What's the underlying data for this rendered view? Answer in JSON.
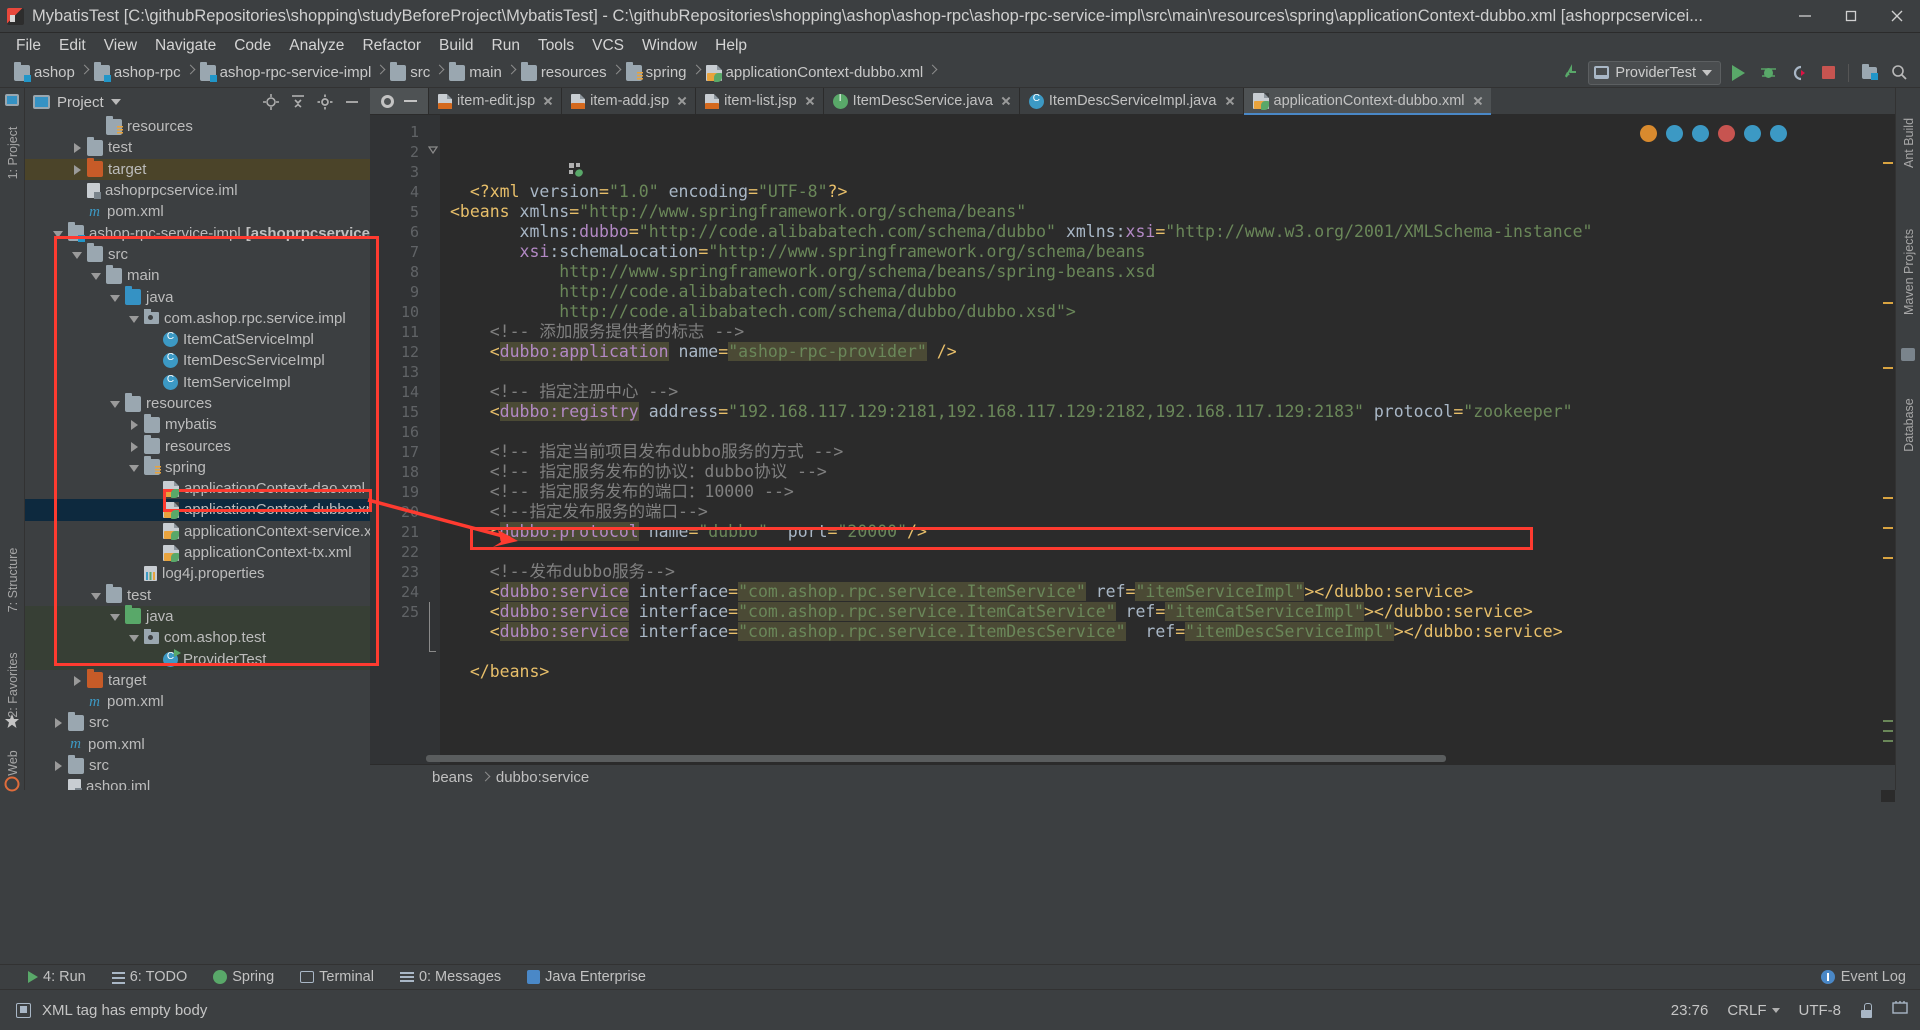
{
  "window": {
    "title": "MybatisTest [C:\\githubRepositories\\shopping\\studyBeforeProject\\MybatisTest] - C:\\githubRepositories\\shopping\\ashop\\ashop-rpc\\ashop-rpc-service-impl\\src\\main\\resources\\spring\\applicationContext-dubbo.xml [ashoprpcservicei...",
    "minimize": "−",
    "maximize": "❐",
    "close": "✕"
  },
  "menubar": {
    "items": [
      {
        "label": "File"
      },
      {
        "label": "Edit"
      },
      {
        "label": "View"
      },
      {
        "label": "Navigate"
      },
      {
        "label": "Code"
      },
      {
        "label": "Analyze"
      },
      {
        "label": "Refactor"
      },
      {
        "label": "Build"
      },
      {
        "label": "Run"
      },
      {
        "label": "Tools"
      },
      {
        "label": "VCS"
      },
      {
        "label": "Window"
      },
      {
        "label": "Help"
      }
    ]
  },
  "navbar": {
    "crumbs": [
      {
        "label": "ashop",
        "icon": "folder-module-icon"
      },
      {
        "label": "ashop-rpc",
        "icon": "folder-module-icon"
      },
      {
        "label": "ashop-rpc-service-impl",
        "icon": "folder-module-icon"
      },
      {
        "label": "src",
        "icon": "folder-icon"
      },
      {
        "label": "main",
        "icon": "folder-icon"
      },
      {
        "label": "resources",
        "icon": "folder-icon"
      },
      {
        "label": "spring",
        "icon": "folder-resource-icon"
      },
      {
        "label": "applicationContext-dubbo.xml",
        "icon": "xml-spring-icon"
      }
    ],
    "run_configuration": "ProviderTest",
    "actions": [
      "update-project-icon",
      "run-icon",
      "debug-icon",
      "run-coverage-icon",
      "stop-icon",
      "project-structure-icon",
      "search-icon"
    ]
  },
  "left_strip": {
    "top_items": [
      "1: Project"
    ],
    "bottom_items": [
      "7: Structure",
      "2: Favorites",
      "Web"
    ]
  },
  "right_strip": {
    "items": [
      "Ant Build",
      "Maven Projects",
      "Database"
    ]
  },
  "project_panel": {
    "title": "Project",
    "actions": [
      "locate-icon",
      "collapse-all-icon",
      "settings-icon",
      "hide-icon"
    ],
    "tree": [
      {
        "depth": 3,
        "label": "resources",
        "icon": "folder-resource-icon",
        "twist": "none"
      },
      {
        "depth": 2,
        "label": "test",
        "icon": "folder-icon",
        "twist": "closed"
      },
      {
        "depth": 2,
        "label": "target",
        "icon": "folder-orange-icon",
        "twist": "closed",
        "row": "highlight"
      },
      {
        "depth": 2,
        "label": "ashoprpcservice.iml",
        "icon": "iml-icon",
        "twist": "none"
      },
      {
        "depth": 2,
        "label": "pom.xml",
        "icon": "maven-icon",
        "twist": "none"
      },
      {
        "depth": 1,
        "label": "ashop-rpc-service-impl",
        "suffix": "[ashoprpcserviceimpl]",
        "icon": "folder-module-icon",
        "twist": "open"
      },
      {
        "depth": 2,
        "label": "src",
        "icon": "folder-icon",
        "twist": "open"
      },
      {
        "depth": 3,
        "label": "main",
        "icon": "folder-icon",
        "twist": "open"
      },
      {
        "depth": 4,
        "label": "java",
        "icon": "folder-source-icon",
        "twist": "open"
      },
      {
        "depth": 5,
        "label": "com.ashop.rpc.service.impl",
        "icon": "package-icon",
        "twist": "open"
      },
      {
        "depth": 6,
        "label": "ItemCatServiceImpl",
        "icon": "class-icon",
        "twist": "none"
      },
      {
        "depth": 6,
        "label": "ItemDescServiceImpl",
        "icon": "class-icon",
        "twist": "none"
      },
      {
        "depth": 6,
        "label": "ItemServiceImpl",
        "icon": "class-icon",
        "twist": "none"
      },
      {
        "depth": 4,
        "label": "resources",
        "icon": "folder-icon",
        "twist": "open"
      },
      {
        "depth": 5,
        "label": "mybatis",
        "icon": "folder-icon",
        "twist": "closed"
      },
      {
        "depth": 5,
        "label": "resources",
        "icon": "folder-icon",
        "twist": "closed"
      },
      {
        "depth": 5,
        "label": "spring",
        "icon": "folder-resource-icon",
        "twist": "open"
      },
      {
        "depth": 6,
        "label": "applicationContext-dao.xml",
        "icon": "xml-spring-icon",
        "twist": "none"
      },
      {
        "depth": 6,
        "label": "applicationContext-dubbo.xml",
        "icon": "xml-spring-icon",
        "twist": "none",
        "row": "selected"
      },
      {
        "depth": 6,
        "label": "applicationContext-service.xml",
        "icon": "xml-spring-icon",
        "twist": "none"
      },
      {
        "depth": 6,
        "label": "applicationContext-tx.xml",
        "icon": "xml-spring-icon",
        "twist": "none"
      },
      {
        "depth": 5,
        "label": "log4j.properties",
        "icon": "properties-icon",
        "twist": "none"
      },
      {
        "depth": 3,
        "label": "test",
        "icon": "folder-icon",
        "twist": "open"
      },
      {
        "depth": 4,
        "label": "java",
        "icon": "folder-test-source-icon",
        "twist": "open",
        "row": "testsrc"
      },
      {
        "depth": 5,
        "label": "com.ashop.test",
        "icon": "package-icon",
        "twist": "open",
        "row": "testsrc"
      },
      {
        "depth": 6,
        "label": "ProviderTest",
        "icon": "class-runnable-icon",
        "twist": "none",
        "row": "testsrc"
      },
      {
        "depth": 2,
        "label": "target",
        "icon": "folder-orange-icon",
        "twist": "closed"
      },
      {
        "depth": 2,
        "label": "pom.xml",
        "icon": "maven-icon",
        "twist": "none"
      },
      {
        "depth": 1,
        "label": "src",
        "icon": "folder-icon",
        "twist": "closed"
      },
      {
        "depth": 1,
        "label": "pom.xml",
        "icon": "maven-icon",
        "twist": "none"
      },
      {
        "depth": 1,
        "label": "src",
        "icon": "folder-icon",
        "twist": "closed"
      },
      {
        "depth": 1,
        "label": "ashop.iml",
        "icon": "iml-icon",
        "twist": "none"
      }
    ]
  },
  "editor": {
    "tabs": [
      {
        "label": "item-edit.jsp",
        "icon": "jsp-icon",
        "active": false
      },
      {
        "label": "item-add.jsp",
        "icon": "jsp-icon",
        "active": false
      },
      {
        "label": "item-list.jsp",
        "icon": "jsp-icon",
        "active": false
      },
      {
        "label": "ItemDescService.java",
        "icon": "interface-icon",
        "active": false
      },
      {
        "label": "ItemDescServiceImpl.java",
        "icon": "class-icon",
        "active": false
      },
      {
        "label": "applicationContext-dubbo.xml",
        "icon": "xml-spring-icon",
        "active": true
      }
    ],
    "line_numbers": [
      "1",
      "2",
      "3",
      "4",
      "5",
      "6",
      "7",
      "8",
      "9",
      "10",
      "11",
      "12",
      "13",
      "14",
      "15",
      "16",
      "17",
      "18",
      "19",
      "20",
      "21",
      "22",
      "23",
      "24",
      "25"
    ],
    "lines": [
      [
        {
          "t": "plain",
          "s": "  "
        },
        {
          "t": "tag",
          "s": "<?xml "
        },
        {
          "t": "attr",
          "s": "version"
        },
        {
          "t": "tag",
          "s": "="
        },
        {
          "t": "val",
          "s": "\"1.0\""
        },
        {
          "t": "plain",
          "s": " "
        },
        {
          "t": "attr",
          "s": "encoding"
        },
        {
          "t": "tag",
          "s": "="
        },
        {
          "t": "val",
          "s": "\"UTF-8\""
        },
        {
          "t": "tag",
          "s": "?>"
        }
      ],
      [
        {
          "t": "tag",
          "s": "<beans "
        },
        {
          "t": "attr",
          "s": "xmlns"
        },
        {
          "t": "tag",
          "s": "="
        },
        {
          "t": "val",
          "s": "\"http://www.springframework.org/schema/beans\""
        }
      ],
      [
        {
          "t": "plain",
          "s": "       "
        },
        {
          "t": "attr",
          "s": "xmlns:"
        },
        {
          "t": "ns",
          "s": "dubbo"
        },
        {
          "t": "tag",
          "s": "="
        },
        {
          "t": "val",
          "s": "\"http://code.alibabatech.com/schema/dubbo\""
        },
        {
          "t": "plain",
          "s": " "
        },
        {
          "t": "attr",
          "s": "xmlns:"
        },
        {
          "t": "ns",
          "s": "xsi"
        },
        {
          "t": "tag",
          "s": "="
        },
        {
          "t": "val",
          "s": "\"http://www.w3.org/2001/XMLSchema-instance\""
        }
      ],
      [
        {
          "t": "plain",
          "s": "       "
        },
        {
          "t": "ns",
          "s": "xsi"
        },
        {
          "t": "attr",
          "s": ":schemaLocation"
        },
        {
          "t": "tag",
          "s": "="
        },
        {
          "t": "val",
          "s": "\"http://www.springframework.org/schema/beans"
        }
      ],
      [
        {
          "t": "val",
          "s": "           http://www.springframework.org/schema/beans/spring-beans.xsd"
        }
      ],
      [
        {
          "t": "val",
          "s": "           http://code.alibabatech.com/schema/dubbo"
        }
      ],
      [
        {
          "t": "val",
          "s": "           http://code.alibabatech.com/schema/dubbo/dubbo.xsd\">"
        }
      ],
      [
        {
          "t": "cmt",
          "s": "    <!-- 添加服务提供者的标志 -->"
        }
      ],
      [
        {
          "t": "tag",
          "s": "    <"
        },
        {
          "t": "hltag",
          "s": "dubbo:application"
        },
        {
          "t": "plain",
          "s": " "
        },
        {
          "t": "attr",
          "s": "name"
        },
        {
          "t": "tag",
          "s": "="
        },
        {
          "t": "valsq",
          "s": "\"ashop-rpc-provider\""
        },
        {
          "t": "tag",
          "s": " />"
        }
      ],
      [
        {
          "t": "plain",
          "s": ""
        }
      ],
      [
        {
          "t": "cmt",
          "s": "    <!-- 指定注册中心 -->"
        }
      ],
      [
        {
          "t": "tag",
          "s": "    <"
        },
        {
          "t": "hltag",
          "s": "dubbo:registry"
        },
        {
          "t": "plain",
          "s": " "
        },
        {
          "t": "attr",
          "s": "address"
        },
        {
          "t": "tag",
          "s": "="
        },
        {
          "t": "val",
          "s": "\"192.168.117.129:2181,192.168.117.129:2182,192.168.117.129:2183\""
        },
        {
          "t": "plain",
          "s": " "
        },
        {
          "t": "attr",
          "s": "protocol"
        },
        {
          "t": "tag",
          "s": "="
        },
        {
          "t": "val",
          "s": "\"zookeeper\""
        }
      ],
      [
        {
          "t": "plain",
          "s": ""
        }
      ],
      [
        {
          "t": "cmt",
          "s": "    <!-- 指定当前项目发布dubbo服务的方式 -->"
        }
      ],
      [
        {
          "t": "cmt",
          "s": "    <!-- 指定服务发布的协议：dubbo协议 -->"
        }
      ],
      [
        {
          "t": "cmt",
          "s": "    <!-- 指定服务发布的端口：10000 -->"
        }
      ],
      [
        {
          "t": "cmt",
          "s": "    <!--指定发布服务的端口-->"
        }
      ],
      [
        {
          "t": "tag",
          "s": "    <"
        },
        {
          "t": "hltag",
          "s": "dubbo:protocol"
        },
        {
          "t": "plain",
          "s": " "
        },
        {
          "t": "attr",
          "s": "name"
        },
        {
          "t": "tag",
          "s": "="
        },
        {
          "t": "val",
          "s": "\"dubbo\""
        },
        {
          "t": "plain",
          "s": "  "
        },
        {
          "t": "attr",
          "s": "port"
        },
        {
          "t": "tag",
          "s": "="
        },
        {
          "t": "val",
          "s": "\"20000\""
        },
        {
          "t": "tag",
          "s": "/>"
        }
      ],
      [
        {
          "t": "plain",
          "s": ""
        }
      ],
      [
        {
          "t": "cmt",
          "s": "    <!--发布dubbo服务-->"
        }
      ],
      [
        {
          "t": "tag",
          "s": "    <"
        },
        {
          "t": "hltag",
          "s": "dubbo:service"
        },
        {
          "t": "plain",
          "s": " "
        },
        {
          "t": "attr",
          "s": "interface"
        },
        {
          "t": "tag",
          "s": "="
        },
        {
          "t": "valsq",
          "s": "\"com.ashop.rpc.service.ItemService\""
        },
        {
          "t": "plain",
          "s": " "
        },
        {
          "t": "attr",
          "s": "ref"
        },
        {
          "t": "tag",
          "s": "="
        },
        {
          "t": "valsq",
          "s": "\"itemServiceImpl\""
        },
        {
          "t": "tag",
          "s": "></dubbo:service>"
        }
      ],
      [
        {
          "t": "tag",
          "s": "    <"
        },
        {
          "t": "hltag",
          "s": "dubbo:service"
        },
        {
          "t": "plain",
          "s": " "
        },
        {
          "t": "attr",
          "s": "interface"
        },
        {
          "t": "tag",
          "s": "="
        },
        {
          "t": "valsq",
          "s": "\"com.ashop.rpc.service.ItemCatService\""
        },
        {
          "t": "plain",
          "s": " "
        },
        {
          "t": "attr",
          "s": "ref"
        },
        {
          "t": "tag",
          "s": "="
        },
        {
          "t": "valsq",
          "s": "\"itemCatServiceImpl\""
        },
        {
          "t": "tag",
          "s": "></dubbo:service>"
        }
      ],
      [
        {
          "t": "tag",
          "s": "    <"
        },
        {
          "t": "hltag",
          "s": "dubbo:service"
        },
        {
          "t": "plain",
          "s": " "
        },
        {
          "t": "attr",
          "s": "interface"
        },
        {
          "t": "tag",
          "s": "="
        },
        {
          "t": "valsq",
          "s": "\"com.ashop.rpc.service.ItemDescService\""
        },
        {
          "t": "plain",
          "s": "  "
        },
        {
          "t": "attr",
          "s": "ref"
        },
        {
          "t": "tag",
          "s": "="
        },
        {
          "t": "valsq",
          "s": "\"itemDescServiceImpl\""
        },
        {
          "t": "tag",
          "s": "></dubbo:service>"
        }
      ],
      [
        {
          "t": "plain",
          "s": ""
        }
      ],
      [
        {
          "t": "tag",
          "s": "  </beans>"
        }
      ]
    ],
    "breadcrumb": [
      "beans",
      "dubbo:service"
    ]
  },
  "bottom_bar": {
    "items": [
      {
        "label": "4: Run",
        "icon": "run-icon"
      },
      {
        "label": "6: TODO",
        "icon": "todo-icon"
      },
      {
        "label": "Spring",
        "icon": "spring-icon"
      },
      {
        "label": "Terminal",
        "icon": "terminal-icon"
      },
      {
        "label": "0: Messages",
        "icon": "messages-icon"
      },
      {
        "label": "Java Enterprise",
        "icon": "java-enterprise-icon"
      }
    ],
    "event_log": "Event Log"
  },
  "statusbar": {
    "message": "XML tag has empty body",
    "caret_position": "23:76",
    "line_separator": "CRLF",
    "encoding": "UTF-8",
    "lock_icon": "lock-icon",
    "status_icon": "status-icon"
  },
  "annotations": {
    "boxes": [
      "project-subtree-highlight",
      "selected-file-highlight",
      "dubbo-service-line-highlight"
    ],
    "arrow_color": "#fe3b30"
  }
}
